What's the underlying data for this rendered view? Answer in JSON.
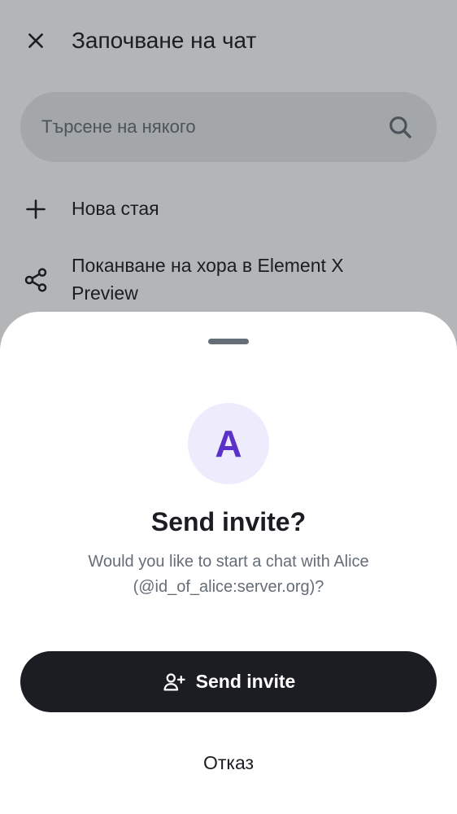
{
  "header": {
    "title": "Започване на чат",
    "close_icon": "close-icon"
  },
  "search": {
    "placeholder": "Търсене на някого",
    "icon": "search-icon"
  },
  "actions": [
    {
      "label": "Нова стая",
      "icon": "plus-icon"
    },
    {
      "label": "Поканване на хора в Element X Preview",
      "icon": "share-icon"
    }
  ],
  "sheet": {
    "avatar_letter": "A",
    "title": "Send invite?",
    "description": "Would you like to start a chat with Alice (@id_of_alice:server.org)?",
    "primary_label": "Send invite",
    "primary_icon": "user-add-icon",
    "secondary_label": "Отказ"
  },
  "colors": {
    "text_primary": "#1b1d22",
    "text_secondary": "#656d77",
    "avatar_bg": "#eeebfd",
    "avatar_fg": "#5a32c9",
    "primary_button_bg": "#1b1d22"
  }
}
